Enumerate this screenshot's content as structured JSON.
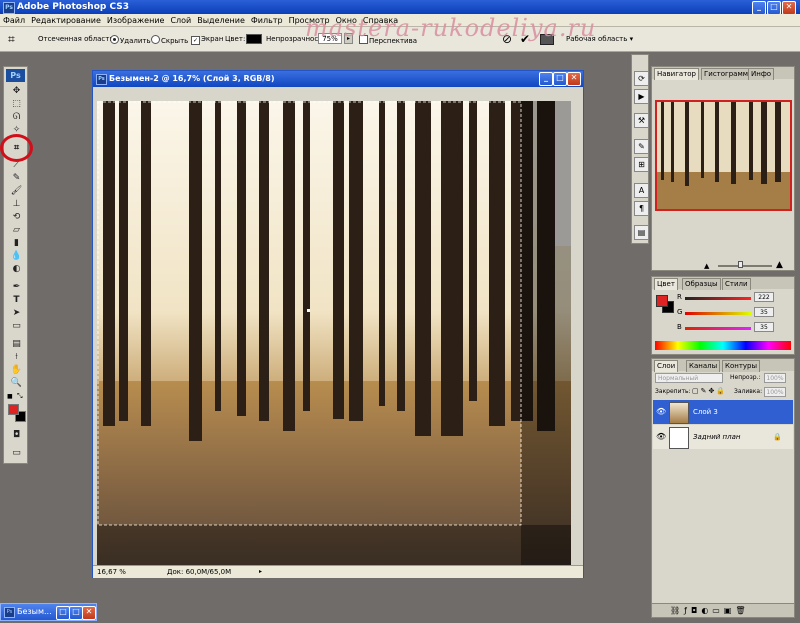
{
  "app": {
    "logo_text": "Ps",
    "title": "Adobe Photoshop CS3",
    "mini_logo": "Ps"
  },
  "window_buttons": {
    "minimize": "_",
    "maximize": "□",
    "close": "✕"
  },
  "menu": [
    "Файл",
    "Редактирование",
    "Изображение",
    "Слой",
    "Выделение",
    "Фильтр",
    "Просмотр",
    "Окно",
    "Справка"
  ],
  "options_bar": {
    "crop_area_label": "Отсеченная область:",
    "delete_label": "Удалить",
    "hide_label": "Скрыть",
    "screen_label": "Экран",
    "color_label": "Цвет:",
    "opacity_label": "Непрозрачность:",
    "opacity_value": "75%",
    "perspective_label": "Перспектива",
    "workspace_label": "Рабочая область",
    "cancel_icon": "⊘",
    "commit_icon": "✔"
  },
  "watermark": "mastera-rukodeliya.ru",
  "document": {
    "title": "Безымен-2 @ 16,7% (Слой 3, RGB/8)",
    "zoom": "16,67 %",
    "doc_size": "Док: 60,0M/65,0M"
  },
  "navigator": {
    "tabs": [
      "Навигатор",
      "Гистограмма",
      "Инфо"
    ]
  },
  "color_panel": {
    "tabs": [
      "Цвет",
      "Образцы",
      "Стили"
    ],
    "channels": [
      {
        "label": "R",
        "value": "222"
      },
      {
        "label": "G",
        "value": "35"
      },
      {
        "label": "B",
        "value": "35"
      }
    ]
  },
  "layers_panel": {
    "tabs": [
      "Слои",
      "Каналы",
      "Контуры"
    ],
    "blend_mode": "Нормальный",
    "opacity_label": "Непрозр.:",
    "opacity_value": "100%",
    "lock_label": "Закрепить:",
    "fill_label": "Заливка:",
    "fill_value": "100%",
    "layers": [
      {
        "name": "Слой 3",
        "selected": true
      },
      {
        "name": "Задний план",
        "selected": false
      }
    ],
    "lock_icon": "🔒"
  },
  "taskbar": {
    "label": "Безым..."
  },
  "colors": {
    "foreground": "#de2323",
    "background": "#000000",
    "selection": "#2f5fd0"
  }
}
